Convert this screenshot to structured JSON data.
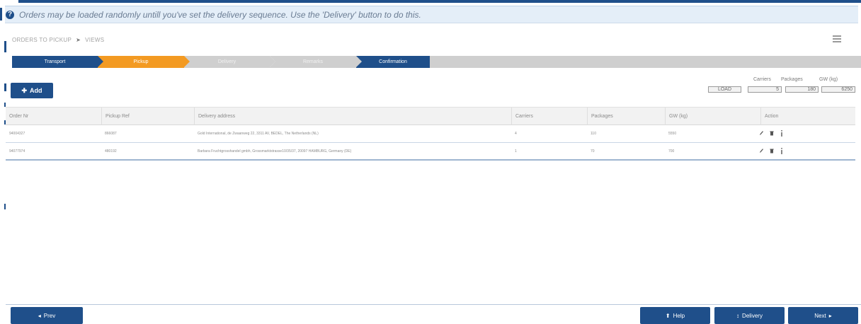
{
  "info_bar": {
    "icon": "question-circle-icon",
    "text": "Orders may be loaded randomly untill you've set the delivery sequence. Use the 'Delivery' button to do this."
  },
  "breadcrumb": {
    "parent": "ORDERS TO PICKUP",
    "separator_icon": "arrow-right-icon",
    "current": "VIEWS"
  },
  "steps": [
    {
      "label": "Transport",
      "state": "done"
    },
    {
      "label": "Pickup",
      "state": "active"
    },
    {
      "label": "Delivery",
      "state": "disabled"
    },
    {
      "label": "Remarks",
      "state": "disabled"
    },
    {
      "label": "Confirmation",
      "state": "done"
    }
  ],
  "toolbar": {
    "add_label": "Add",
    "add_icon": "plus-icon"
  },
  "totals": {
    "headers": [
      "Carriers",
      "Packages",
      "GW (kg)"
    ],
    "load_label": "LOAD",
    "carriers": "5",
    "packages": "180",
    "gw": "6250"
  },
  "table": {
    "columns": [
      "Order Nr",
      "Pickup Ref",
      "Delivery address",
      "Carriers",
      "Packages",
      "GW (kg)",
      "Action"
    ],
    "rows": [
      {
        "order_nr": "94004327",
        "pickup_ref": "866087",
        "delivery_address": "Gold International, de Zwaanweg 22, 3311 AV, BEDEL, The Netherlands (NL)",
        "carriers": "4",
        "packages": "110",
        "gw": "5550"
      },
      {
        "order_nr": "94077974",
        "pickup_ref": "480192",
        "delivery_address": "Barbara Fruchtgrosshandel gmbh, Grossmarktstrasse10/35/37, 20097 HAMBURG, Germany (DE)",
        "carriers": "1",
        "packages": "70",
        "gw": "700"
      }
    ],
    "action_icons": [
      "pencil-icon",
      "trash-icon",
      "info-icon"
    ]
  },
  "footer": {
    "prev_label": "Prev",
    "help_label": "Help",
    "delivery_label": "Delivery",
    "next_label": "Next"
  },
  "colors": {
    "primary": "#1f4f8a",
    "active_step": "#f39a22",
    "disabled_step": "#cfcfcf",
    "info_bg": "#e4eef8"
  }
}
